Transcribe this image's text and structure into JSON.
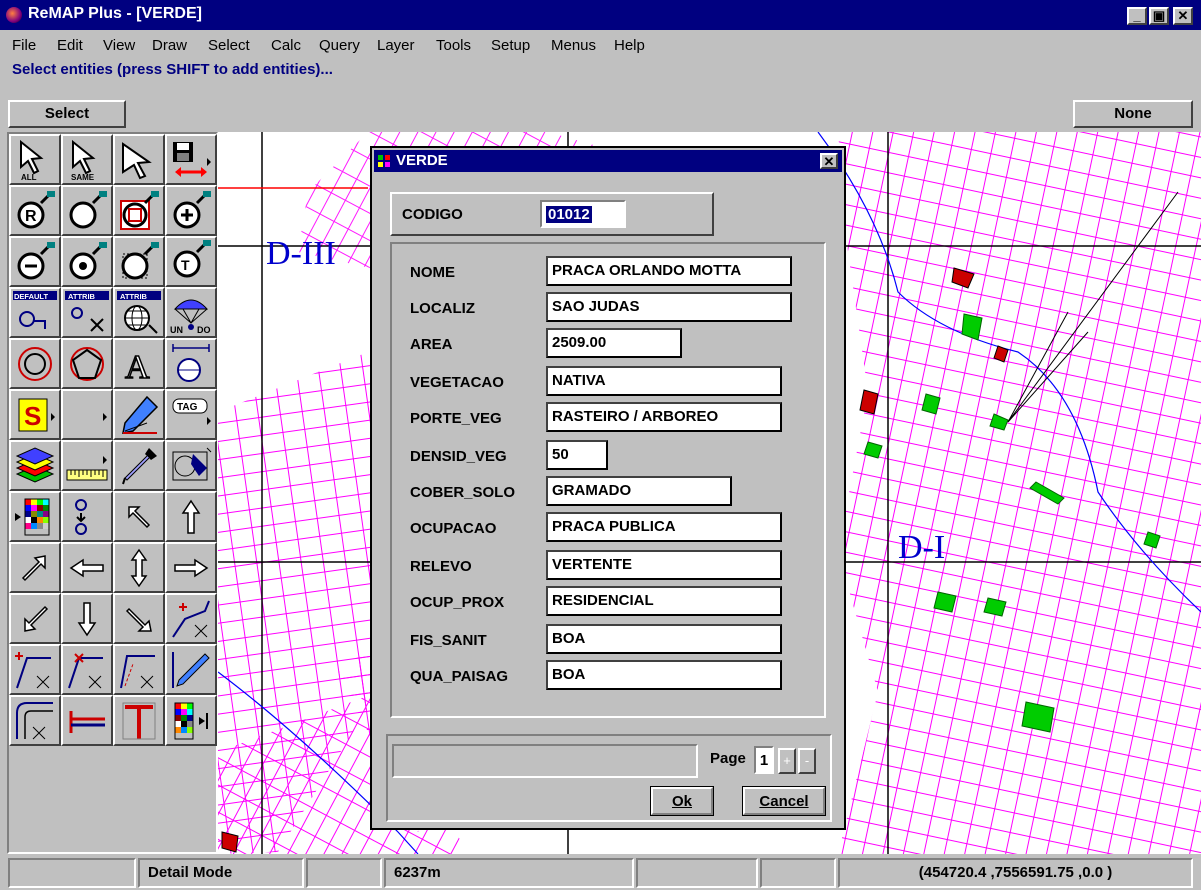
{
  "app": {
    "title": "ReMAP Plus - [VERDE]",
    "window_controls": {
      "minimize": "_",
      "restore": "▣",
      "close": "✕"
    }
  },
  "menu": [
    "File",
    "Edit",
    "View",
    "Draw",
    "Select",
    "Calc",
    "Query",
    "Layer",
    "Tools",
    "Setup",
    "Menus",
    "Help"
  ],
  "prompt": "Select entities (press SHIFT to add entities)...",
  "mode_box": "Select",
  "layer_box": "None",
  "toolbox": {
    "label_all": "ALL",
    "label_same": "SAME",
    "label_default": "DEFAULT",
    "label_attrib": "ATTRIB",
    "label_undo": "UN",
    "label_undo_b": "DO",
    "label_tag": "TAG",
    "label_s": "S"
  },
  "map": {
    "labels": [
      "D-III",
      "D-I"
    ],
    "colors": {
      "streets": "#ff00ff",
      "grid": "#000000",
      "river": "#0000ff",
      "parks": "#00cc00",
      "lots": "#cc0000",
      "border": "#ff0000"
    }
  },
  "dialog": {
    "title": "VERDE",
    "close": "✕",
    "codigo_label": "CODIGO",
    "codigo_value": "01012",
    "fields": [
      {
        "label": "NOME",
        "value": "PRACA ORLANDO MOTTA"
      },
      {
        "label": "LOCALIZ",
        "value": "SAO JUDAS"
      },
      {
        "label": "AREA",
        "value": "2509.00"
      },
      {
        "label": "VEGETACAO",
        "value": "NATIVA"
      },
      {
        "label": "PORTE_VEG",
        "value": "RASTEIRO / ARBOREO"
      },
      {
        "label": "DENSID_VEG",
        "value": "50"
      },
      {
        "label": "COBER_SOLO",
        "value": "GRAMADO"
      },
      {
        "label": "OCUPACAO",
        "value": "PRACA PUBLICA"
      },
      {
        "label": "RELEVO",
        "value": "VERTENTE"
      },
      {
        "label": "OCUP_PROX",
        "value": "RESIDENCIAL"
      },
      {
        "label": "FIS_SANIT",
        "value": "BOA"
      },
      {
        "label": "QUA_PAISAG",
        "value": "BOA"
      }
    ],
    "page_label": "Page",
    "page_number": "1",
    "page_next": "+",
    "page_prev": "-",
    "ok_label": "Ok",
    "cancel_label": "Cancel"
  },
  "status": {
    "mode": "Detail Mode",
    "scale": "6237m",
    "coords": "(454720.4 ,7556591.75 ,0.0 )"
  }
}
